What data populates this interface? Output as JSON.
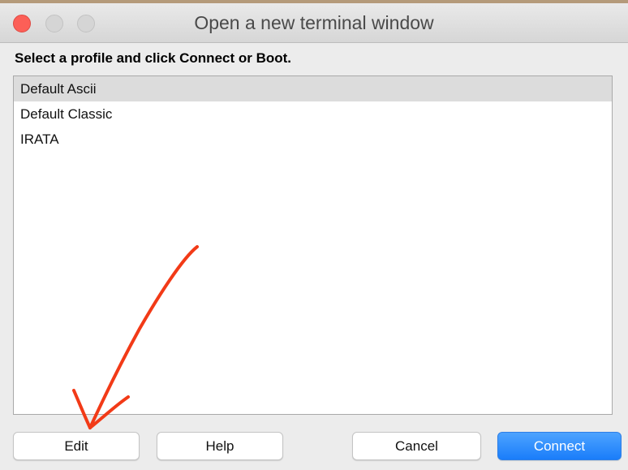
{
  "window": {
    "title": "Open a new terminal window"
  },
  "prompt": "Select a profile and click Connect or Boot.",
  "profiles": [
    {
      "label": "Default Ascii",
      "selected": true
    },
    {
      "label": "Default Classic",
      "selected": false
    },
    {
      "label": "IRATA",
      "selected": false
    }
  ],
  "buttons": {
    "edit": "Edit",
    "help": "Help",
    "cancel": "Cancel",
    "connect": "Connect"
  },
  "colors": {
    "accent": "#1a7dfa",
    "close": "#fc5f57",
    "annotation_arrow": "#f23a17"
  }
}
